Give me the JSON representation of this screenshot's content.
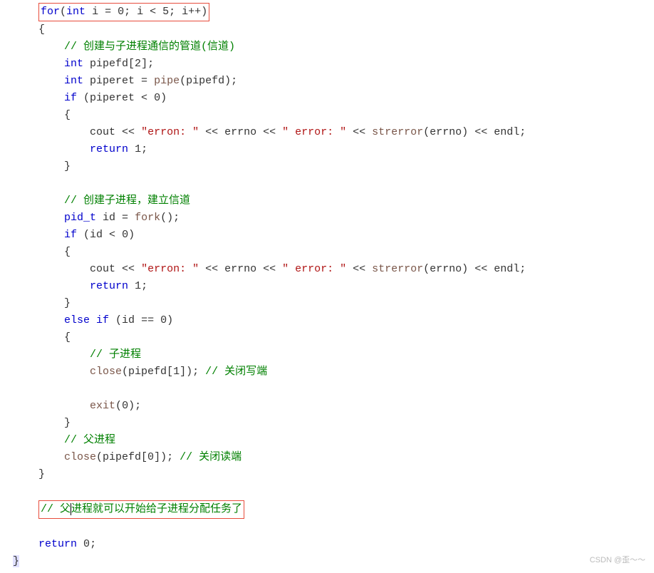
{
  "code": {
    "line1": {
      "for": "for",
      "int": "int",
      "i": " i ",
      "eq": "= ",
      "zero": "0",
      "semi1": "; i ",
      "lt": "< ",
      "five": "5",
      "semi2": "; i",
      "inc": "++",
      "close": ")"
    },
    "line2": "{",
    "line3_comment": "// 创建与子进程通信的管道(信道)",
    "line4": {
      "int": "int",
      "rest": " pipefd[",
      "two": "2",
      "close": "];"
    },
    "line5": {
      "int": "int",
      "var": " piperet ",
      "eq": "= ",
      "func": "pipe",
      "arg": "(pipefd);"
    },
    "line6": {
      "if": "if",
      "cond": " (piperet ",
      "lt": "< ",
      "zero": "0",
      "close": ")"
    },
    "line7": "{",
    "line8": {
      "cout": "cout ",
      "op1": "<< ",
      "str1": "\"erron: \"",
      "op2": " << ",
      "errno1": "errno ",
      "op3": "<< ",
      "str2": "\" error: \"",
      "op4": " << ",
      "func": "strerror",
      "arg": "(errno) ",
      "op5": "<< ",
      "endl": "endl;"
    },
    "line9": {
      "return": "return",
      "val": " ",
      "one": "1",
      "semi": ";"
    },
    "line10": "}",
    "line12_comment": "// 创建子进程，建立信道",
    "line13": {
      "type": "pid_t",
      "var": " id ",
      "eq": "= ",
      "func": "fork",
      "args": "();"
    },
    "line14": {
      "if": "if",
      "cond": " (id ",
      "lt": "< ",
      "zero": "0",
      "close": ")"
    },
    "line15": "{",
    "line16": {
      "cout": "cout ",
      "op1": "<< ",
      "str1": "\"erron: \"",
      "op2": " << ",
      "errno1": "errno ",
      "op3": "<< ",
      "str2": "\" error: \"",
      "op4": " << ",
      "func": "strerror",
      "arg": "(errno) ",
      "op5": "<< ",
      "endl": "endl;"
    },
    "line17": {
      "return": "return",
      "val": " ",
      "one": "1",
      "semi": ";"
    },
    "line18": "}",
    "line19": {
      "else": "else",
      "if": " if",
      "cond": " (id ",
      "eq": "== ",
      "zero": "0",
      "close": ")"
    },
    "line20": "{",
    "line21_comment": "// 子进程",
    "line22": {
      "func": "close",
      "open": "(pipefd[",
      "one": "1",
      "close": "]); ",
      "comment": "// 关闭写端"
    },
    "line24": {
      "func": "exit",
      "open": "(",
      "zero": "0",
      "close": ");"
    },
    "line25": "}",
    "line26_comment": "// 父进程",
    "line27": {
      "func": "close",
      "open": "(pipefd[",
      "zero": "0",
      "close": "]); ",
      "comment": "// 关闭读端"
    },
    "line28": "}",
    "line30_comment": "// 父进程就可以开始给子进程分配任务了",
    "line30_prefix": "// 父",
    "line30_suffix": "进程就可以开始给子进程分配任务了",
    "line32": {
      "return": "return",
      "val": " ",
      "zero": "0",
      "semi": ";"
    },
    "line33": "}"
  },
  "watermark": "CSDN @歪～～"
}
